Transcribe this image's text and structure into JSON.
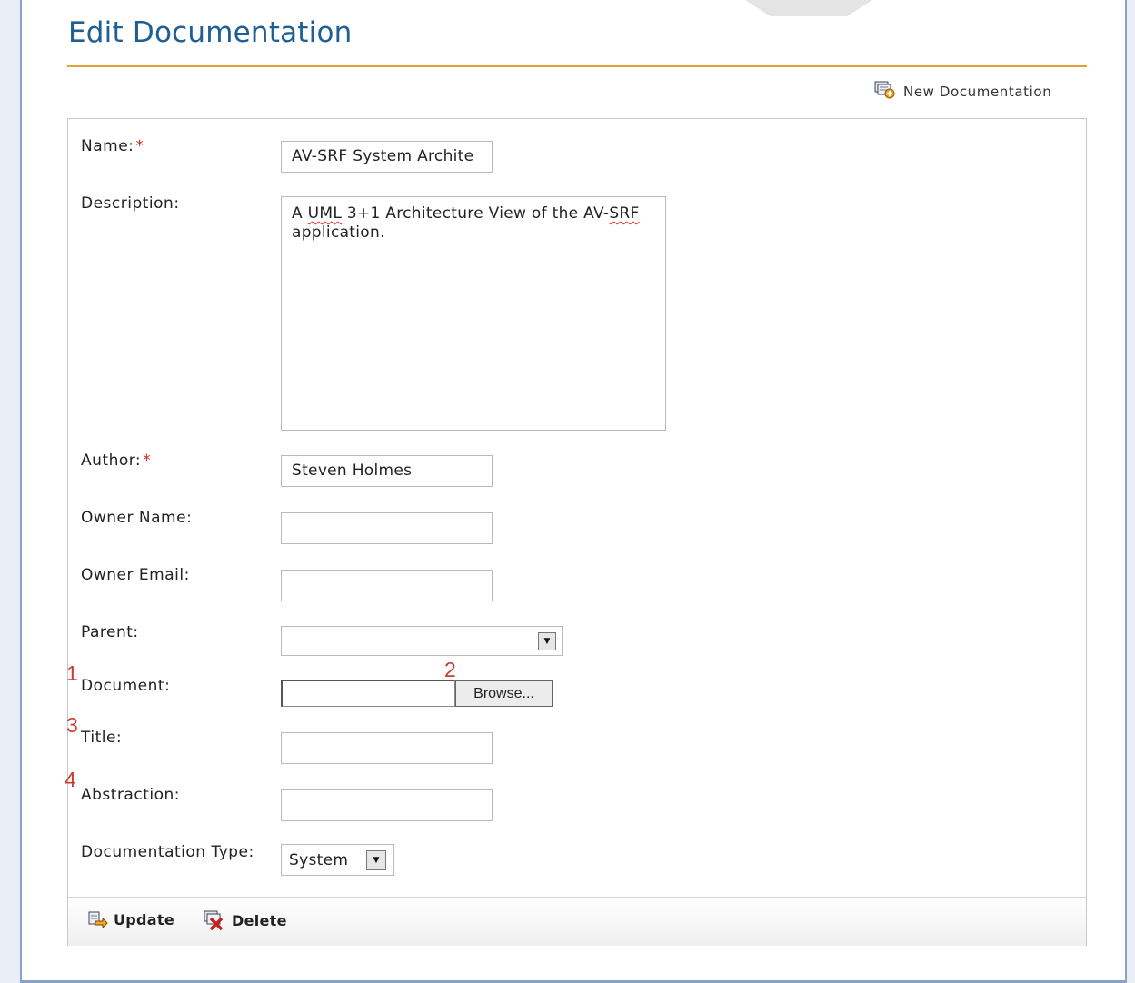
{
  "page": {
    "title": "Edit Documentation",
    "new_link_label": "New Documentation"
  },
  "form": {
    "name": {
      "label": "Name:",
      "required_mark": "*",
      "value": "AV-SRF System Archite"
    },
    "description": {
      "label": "Description:",
      "value_pre": "A ",
      "value_uml": "UML",
      "value_mid": " 3+1 Architecture View of the AV-",
      "value_srf": "SRF",
      "value_post": " application."
    },
    "author": {
      "label": "Author:",
      "required_mark": "*",
      "value": "Steven Holmes"
    },
    "owner_name": {
      "label": "Owner Name:",
      "value": ""
    },
    "owner_email": {
      "label": "Owner Email:",
      "value": ""
    },
    "parent": {
      "label": "Parent:",
      "value": ""
    },
    "document": {
      "label": "Document:",
      "browse_label": "Browse..."
    },
    "title": {
      "label": "Title:",
      "value": ""
    },
    "abstraction": {
      "label": "Abstraction:",
      "value": ""
    },
    "doc_type": {
      "label": "Documentation Type:",
      "value": "System"
    }
  },
  "markers": [
    "1",
    "2",
    "3",
    "4"
  ],
  "footer": {
    "update_label": "Update",
    "delete_label": "Delete"
  },
  "colors": {
    "title": "#1f5f96",
    "rule": "#e0a33a",
    "required": "#d12020",
    "marker": "#cc3b2e"
  }
}
